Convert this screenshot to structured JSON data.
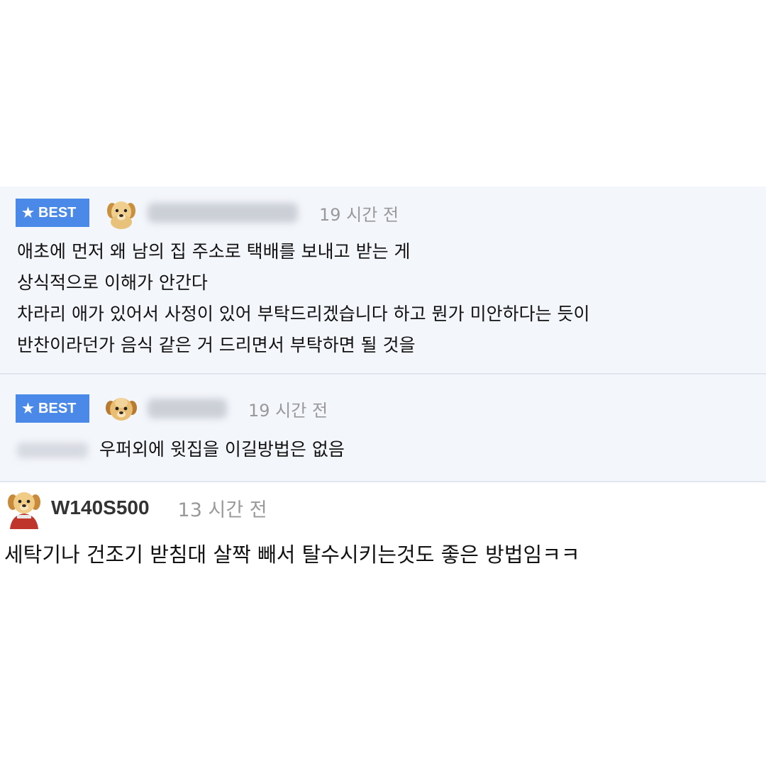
{
  "comments": [
    {
      "badge": "BEST",
      "badge_icon": "star-icon",
      "time": "19 시간 전",
      "lines": [
        "애초에 먼저 왜 남의 집 주소로 택배를 보내고 받는 게",
        "상식적으로 이해가 안간다",
        "차라리 애가 있어서 사정이 있어 부탁드리겠습니다 하고 뭔가 미안하다는 듯이",
        "반찬이라던가 음식 같은 거 드리면서 부탁하면 될 것을"
      ]
    },
    {
      "badge": "BEST",
      "badge_icon": "star-icon",
      "time": "19 시간 전",
      "lines": [
        "우퍼외에 윗집을 이길방법은 없음"
      ]
    },
    {
      "username": "W140S500",
      "time": "13 시간 전",
      "lines": [
        "세탁기나 건조기 받침대 살짝 빼서 탈수시키는것도 좋은 방법임ㅋㅋ"
      ]
    }
  ],
  "colors": {
    "badge_bg": "#4a89e8",
    "best_row_bg": "#f3f6fb",
    "time_text": "#999999"
  }
}
